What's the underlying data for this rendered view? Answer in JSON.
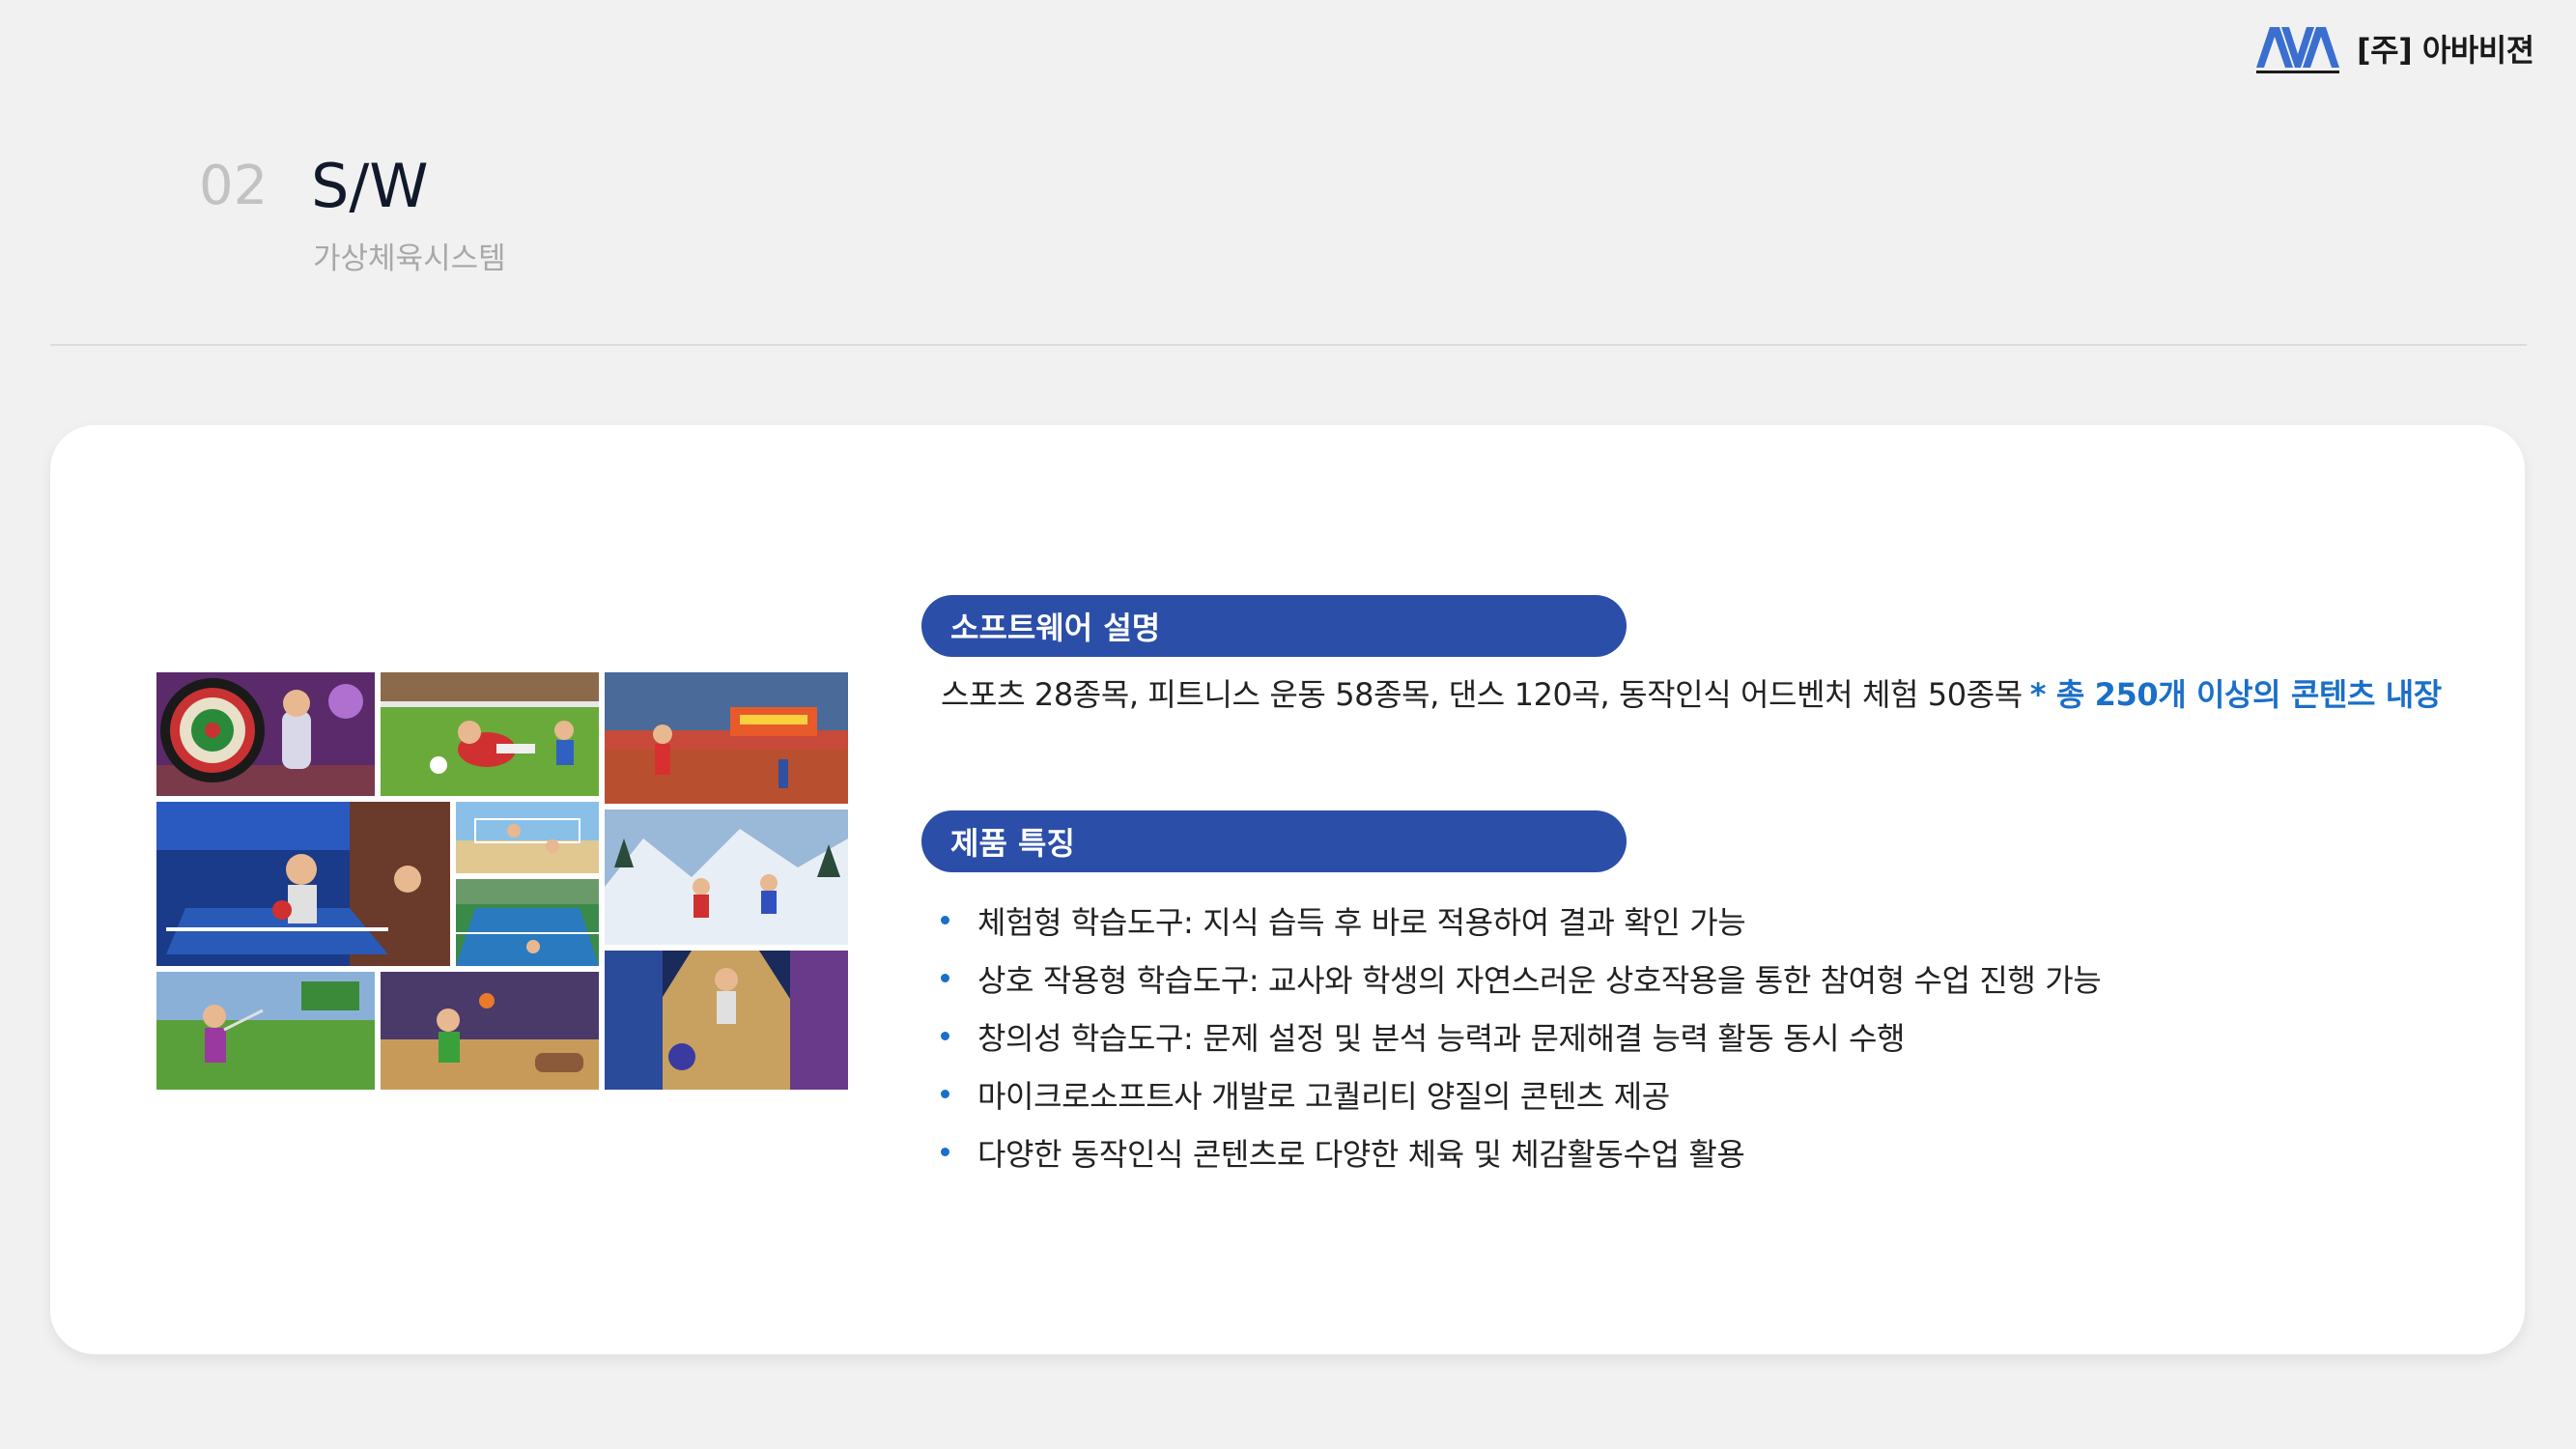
{
  "logo": {
    "mark_text": "AVA",
    "company": "[주] 아바비젼"
  },
  "section": {
    "number": "02",
    "title": "S/W",
    "subtitle": "가상체육시스템"
  },
  "software": {
    "heading": "소프트웨어 설명",
    "description": "스포츠 28종목, 피트니스 운동 58종목, 댄스 120곡, 동작인식 어드벤처 체험 50종목",
    "highlight": "* 총 250개 이상의 콘텐츠 내장"
  },
  "features": {
    "heading": "제품 특징",
    "items": [
      {
        "text": "체험형 학습도구: 지식 습득 후 바로 적용하여 결과 확인 가능"
      },
      {
        "text": "상호 작용형 학습도구: 교사와 학생의 자연스러운 상호작용을 통한 참여형 수업 진행 가능"
      },
      {
        "text": "창의성 학습도구: 문제 설정 및 분석 능력과 문제해결 능력 활동 동시 수행"
      },
      {
        "text": "마이크로소프트사 개발로 고퀄리티 양질의 콘텐츠 제공"
      },
      {
        "text": "다양한 동작인식 콘텐츠로 다양한 체육 및 체감활동수업 활용"
      }
    ]
  },
  "colors": {
    "accent": "#2b4ea8",
    "highlight": "#1a6fc9",
    "card": "#ffffff",
    "background": "#f1f1f1"
  },
  "mosaic": {
    "tiles": [
      {
        "name": "darts-tile"
      },
      {
        "name": "soccer-tile"
      },
      {
        "name": "track-tile"
      },
      {
        "name": "table-tennis-tile"
      },
      {
        "name": "beach-volleyball-tile"
      },
      {
        "name": "tennis-tile"
      },
      {
        "name": "skiing-tile"
      },
      {
        "name": "golf-tile"
      },
      {
        "name": "basketball-tile"
      },
      {
        "name": "bowling-tile"
      }
    ]
  }
}
